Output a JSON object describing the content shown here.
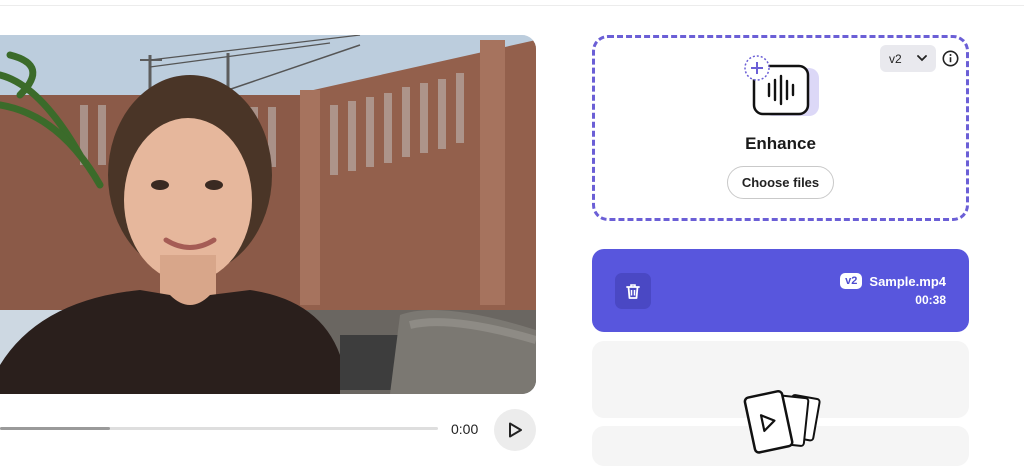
{
  "player": {
    "time": "0:00",
    "progress": 0.25,
    "play_icon": "play-icon"
  },
  "dropzone": {
    "version": "v2",
    "title": "Enhance",
    "choose_label": "Choose files",
    "icons": [
      "enhance-audio-icon",
      "chevron-down-icon",
      "info-icon"
    ],
    "border_color": "#6b5fd6"
  },
  "file_card": {
    "badge": "v2",
    "name": "Sample.mp4",
    "duration": "00:38",
    "icon": "trash-icon",
    "bg_color": "#5856dd"
  },
  "empty_state": {
    "icon": "video-files-icon"
  }
}
